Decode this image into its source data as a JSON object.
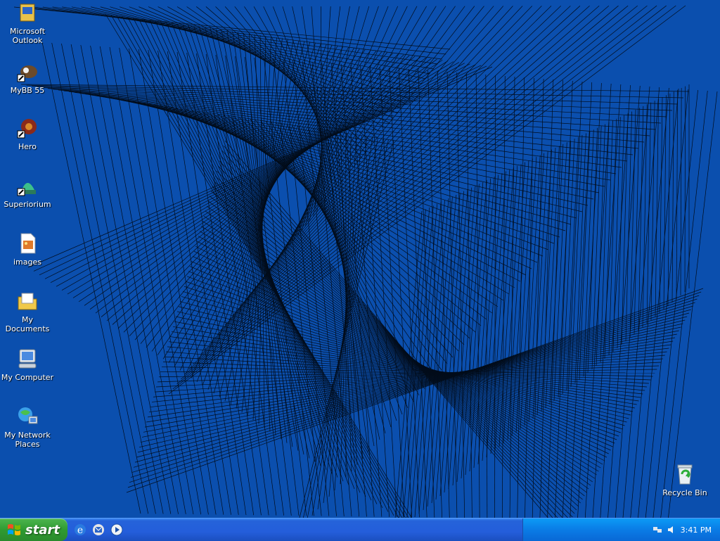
{
  "desktop": {
    "background_color": "#0b4fae",
    "icons": [
      {
        "label": "Microsoft Outlook",
        "icon": "outlook-icon"
      },
      {
        "label": "MyBB 55",
        "icon": "shortcut-app-icon"
      },
      {
        "label": "Hero",
        "icon": "shortcut-game-icon"
      },
      {
        "label": "Superiorium",
        "icon": "shortcut-app-icon"
      },
      {
        "label": "images",
        "icon": "image-file-icon"
      },
      {
        "label": "My Documents",
        "icon": "my-documents-icon"
      },
      {
        "label": "My Computer",
        "icon": "my-computer-icon"
      },
      {
        "label": "My Network Places",
        "icon": "network-places-icon"
      },
      {
        "label": "Recycle Bin",
        "icon": "recycle-bin-icon"
      }
    ]
  },
  "taskbar": {
    "start_label": "start",
    "quick_launch": [
      "internet-explorer-icon",
      "outlook-express-icon",
      "media-player-icon"
    ],
    "clock": "3:41 PM"
  }
}
